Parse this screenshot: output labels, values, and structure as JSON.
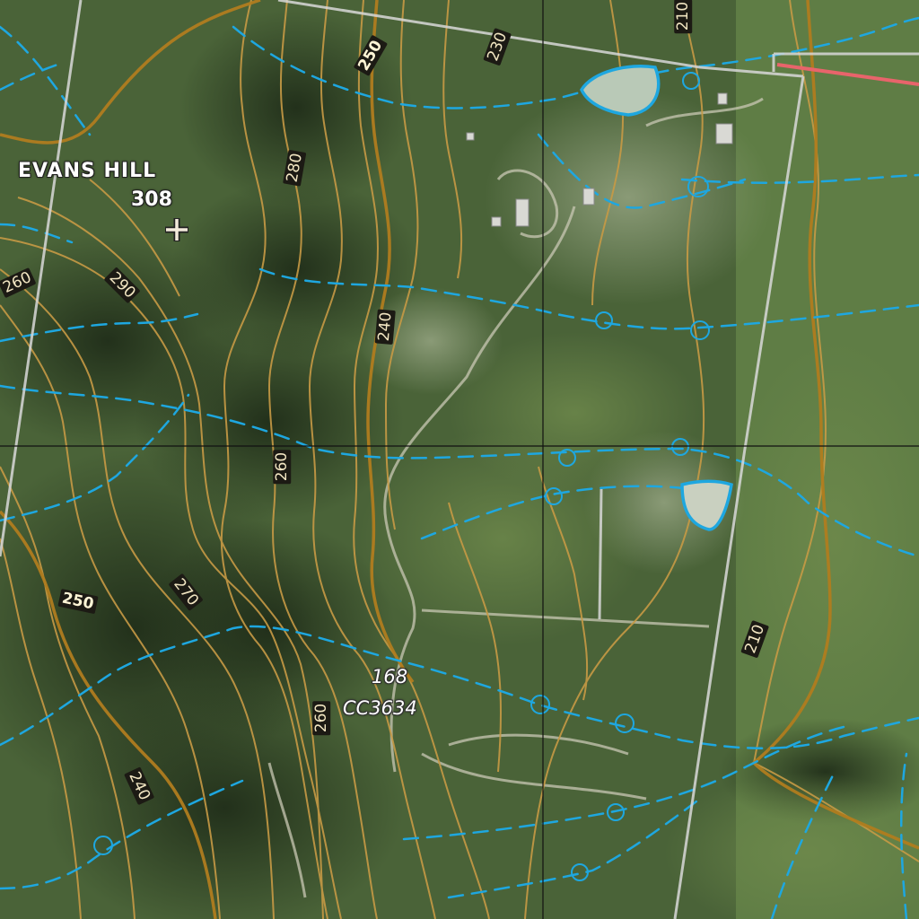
{
  "map": {
    "peak": {
      "name": "EVANS HILL",
      "elevation": "308"
    },
    "parcel": {
      "number": "168",
      "id": "CC3634"
    },
    "contour_labels": [
      "210",
      "230",
      "250",
      "280",
      "260",
      "290",
      "240",
      "260",
      "250",
      "270",
      "260",
      "240",
      "210"
    ],
    "colors": {
      "contour": "#c79a45",
      "index_contour": "#b07c1f",
      "watercourse": "#1ea7e0",
      "boundary": "#d8d8d8",
      "grid": "#111111",
      "road_red": "#e8646b",
      "vegetation_dark": "#2c3f24",
      "vegetation_light": "#6f8a55"
    },
    "icons": [
      "peak-cross-icon",
      "dam-icon"
    ]
  }
}
